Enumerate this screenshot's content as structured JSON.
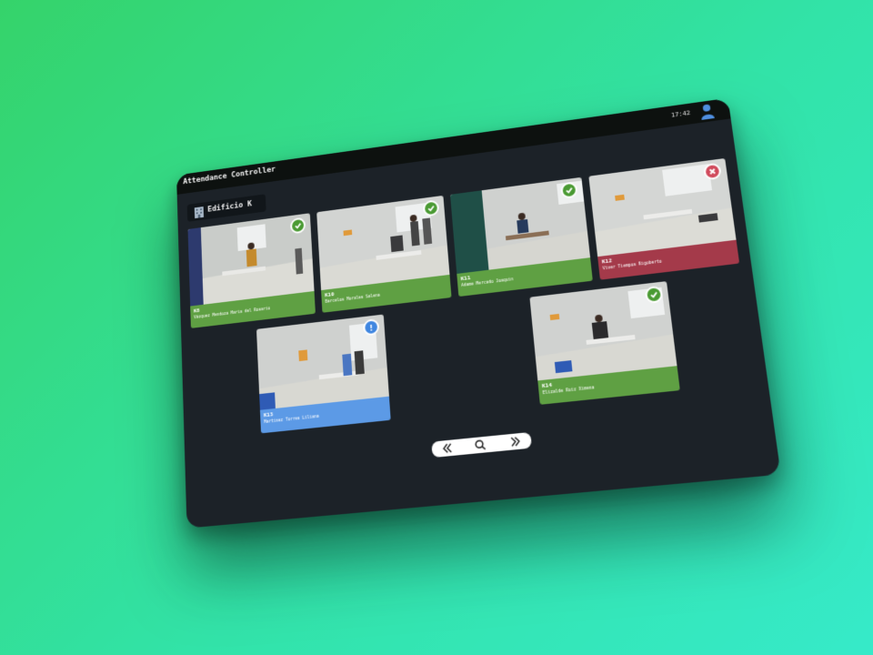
{
  "app": {
    "title": "Attendance Controller",
    "time": "17:42",
    "user_icon": "user-icon"
  },
  "building": {
    "label": "Edificio K",
    "icon": "building-icon"
  },
  "status_colors": {
    "present": "#5fa043",
    "absent": "#a43a4a",
    "pending": "#5c9ae6"
  },
  "rooms": [
    {
      "room": "K8",
      "name": "Vázquez Mendoza María del Rosario",
      "status": "present",
      "status_icon": "check-icon"
    },
    {
      "room": "K10",
      "name": "Barcelos Morales Salena",
      "status": "present",
      "status_icon": "check-icon"
    },
    {
      "room": "K11",
      "name": "Adame Mercado Joaquín",
      "status": "present",
      "status_icon": "check-icon"
    },
    {
      "room": "K12",
      "name": "Viver Tiempos Rigoberto",
      "status": "absent",
      "status_icon": "close-icon"
    },
    {
      "room": "K13",
      "name": "Martínez Torres Liliana",
      "status": "pending",
      "status_icon": "alert-icon"
    },
    {
      "room": "K14",
      "name": "Elizalde Ruiz Ximena",
      "status": "present",
      "status_icon": "check-icon"
    }
  ],
  "pager": {
    "prev_icon": "double-chevron-left-icon",
    "search_icon": "search-icon",
    "next_icon": "double-chevron-right-icon"
  }
}
